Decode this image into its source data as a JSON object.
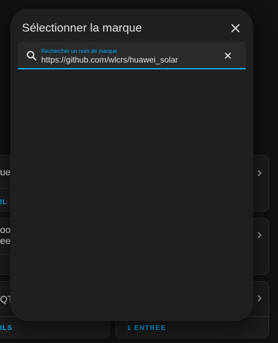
{
  "dialog": {
    "title": "Sélectionner la marque",
    "close_icon": "close-icon"
  },
  "search": {
    "label": "Rechercher un nom de marque",
    "value": "https://github.com/wlcrs/huawei_solar",
    "icon": "search-icon",
    "clear_icon": "clear-icon"
  },
  "background_cards": [
    {
      "partial_text": "uet",
      "link_partial": "IL"
    },
    {
      "partial_text_line1": "oog",
      "partial_text_line2": "eed"
    },
    {
      "partial_text": "QTT",
      "link_partial": "ILS"
    }
  ],
  "background_right_cards": [
    {
      "link": "1 ENTRÉE"
    }
  ],
  "colors": {
    "accent": "#03a9f4",
    "dialog_bg": "#1f1f1f",
    "page_bg": "#111111",
    "text": "#e1e1e1"
  }
}
